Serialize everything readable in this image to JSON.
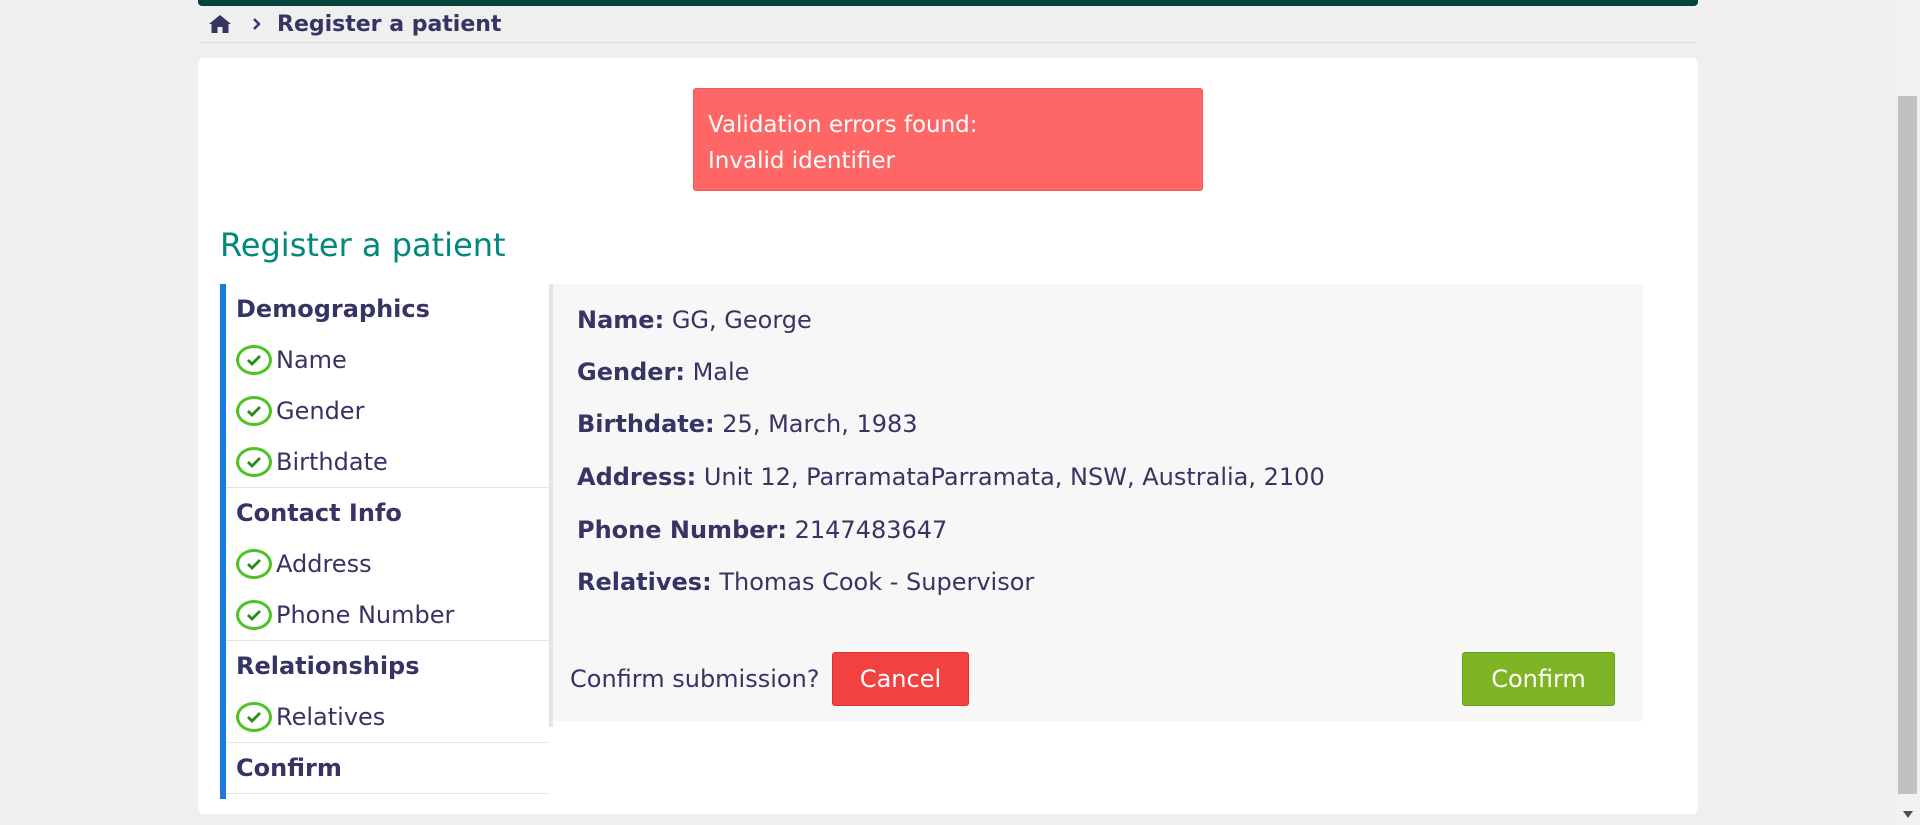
{
  "breadcrumb": {
    "home_icon": "home-icon",
    "separator_icon": "chevron-right-icon",
    "current": "Register a patient"
  },
  "alert": {
    "line1": "Validation errors found:",
    "line2": "Invalid identifier",
    "color": "#ff6666"
  },
  "page": {
    "title": "Register a patient"
  },
  "sidebar": {
    "sections": [
      {
        "title": "Demographics",
        "steps": [
          "Name",
          "Gender",
          "Birthdate"
        ]
      },
      {
        "title": "Contact Info",
        "steps": [
          "Address",
          "Phone Number"
        ]
      },
      {
        "title": "Relationships",
        "steps": [
          "Relatives"
        ]
      },
      {
        "title": "Confirm",
        "steps": []
      }
    ],
    "accent_color": "#1a7ae0",
    "check_color": "#4fc224"
  },
  "summary": {
    "name_label": "Name:",
    "name_value": "GG, George",
    "gender_label": "Gender:",
    "gender_value": "Male",
    "birthdate_label": "Birthdate:",
    "birthdate_value": "25, March, 1983",
    "address_label": "Address:",
    "address_value": "Unit 12, ParramataParramata, NSW, Australia, 2100",
    "phone_label": "Phone Number:",
    "phone_value": "2147483647",
    "relatives_label": "Relatives:",
    "relatives_value": "Thomas Cook - Supervisor"
  },
  "actions": {
    "question": "Confirm submission?",
    "cancel_label": "Cancel",
    "confirm_label": "Confirm",
    "cancel_color": "#f24141",
    "confirm_color": "#7fb524"
  },
  "theme": {
    "header_color": "#00463f",
    "title_color": "#00897b",
    "text_color": "#363463"
  }
}
